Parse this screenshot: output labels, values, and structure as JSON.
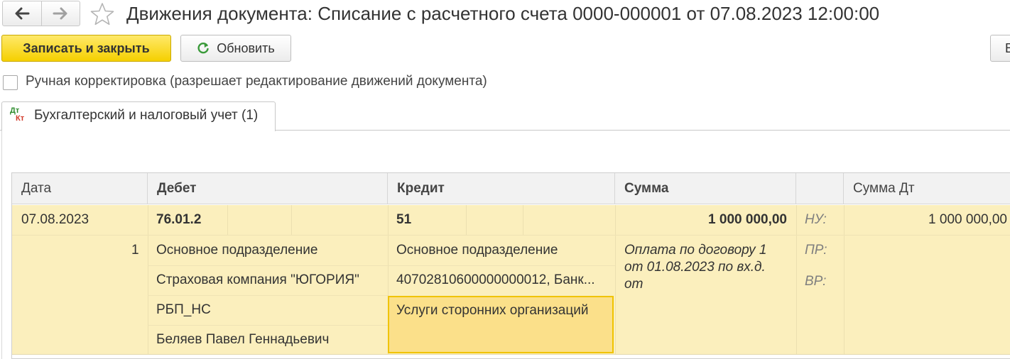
{
  "window": {
    "title": "Движения документа: Списание с расчетного счета 0000-000001 от 07.08.2023 12:00:00"
  },
  "nav": {
    "back_icon": "arrow-left-icon",
    "forward_icon": "arrow-right-icon",
    "favorite_icon": "star-icon"
  },
  "toolbar": {
    "save_close_label": "Записать и закрыть",
    "refresh_label": "Обновить",
    "more_label": "Е"
  },
  "manual_edit": {
    "label": "Ручная корректировка (разрешает редактирование движений документа)",
    "checked": false
  },
  "tabs": [
    {
      "label": "Бухгалтерский и налоговый учет (1)",
      "icon_dt": "Дт",
      "icon_kt": "Кт"
    }
  ],
  "table": {
    "columns": [
      "Дата",
      "Дебет",
      "Кредит",
      "Сумма",
      "",
      "Сумма Дт"
    ],
    "rows": [
      {
        "date": "07.08.2023",
        "number": "1",
        "debit_account": "76.01.2",
        "debit_subconto": [
          "Основное подразделение",
          "Страховая компания \"ЮГОРИЯ\"",
          "РБП_НС",
          "Беляев Павел Геннадьевич"
        ],
        "credit_account": "51",
        "credit_subconto": [
          "Основное подразделение",
          "40702810600000000012, Банк...",
          "Услуги сторонних организаций"
        ],
        "amount": "1 000 000,00",
        "content": "Оплата по договору 1 от 01.08.2023 по вх.д. от",
        "tax_labels": [
          "НУ:",
          "ПР:",
          "ВР:"
        ],
        "amount_dt": "1 000 000,00"
      }
    ]
  },
  "colors": {
    "accent_yellow": "#f5d000",
    "row_highlight": "#fbefbd",
    "selected_cell": "#fbe08a"
  }
}
